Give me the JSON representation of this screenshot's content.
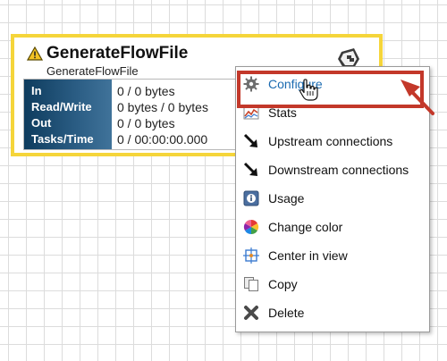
{
  "processor": {
    "name": "GenerateFlowFile",
    "type": "GenerateFlowFile",
    "stats": [
      {
        "label": "In",
        "value": "0 / 0 bytes"
      },
      {
        "label": "Read/Write",
        "value": "0 bytes / 0 bytes"
      },
      {
        "label": "Out",
        "value": "0 / 0 bytes"
      },
      {
        "label": "Tasks/Time",
        "value": "0 / 00:00:00.000"
      }
    ],
    "border_color": "#f5d53a",
    "icons": {
      "warning": "warning-icon",
      "logo": "processor-logo-icon"
    }
  },
  "context_menu": {
    "items": [
      {
        "label": "Configure",
        "icon": "gear-icon",
        "active": true
      },
      {
        "label": "Stats",
        "icon": "stats-chart-icon"
      },
      {
        "label": "Upstream connections",
        "icon": "upstream-arrow-icon"
      },
      {
        "label": "Downstream connections",
        "icon": "downstream-arrow-icon"
      },
      {
        "label": "Usage",
        "icon": "usage-info-icon"
      },
      {
        "label": "Change color",
        "icon": "color-wheel-icon"
      },
      {
        "label": "Center in view",
        "icon": "center-target-icon"
      },
      {
        "label": "Copy",
        "icon": "copy-icon"
      },
      {
        "label": "Delete",
        "icon": "delete-x-icon"
      }
    ]
  },
  "annotation": {
    "color": "#c3382a"
  },
  "colors": {
    "link": "#1a6ab0",
    "stats_header": "#1f4e74"
  }
}
